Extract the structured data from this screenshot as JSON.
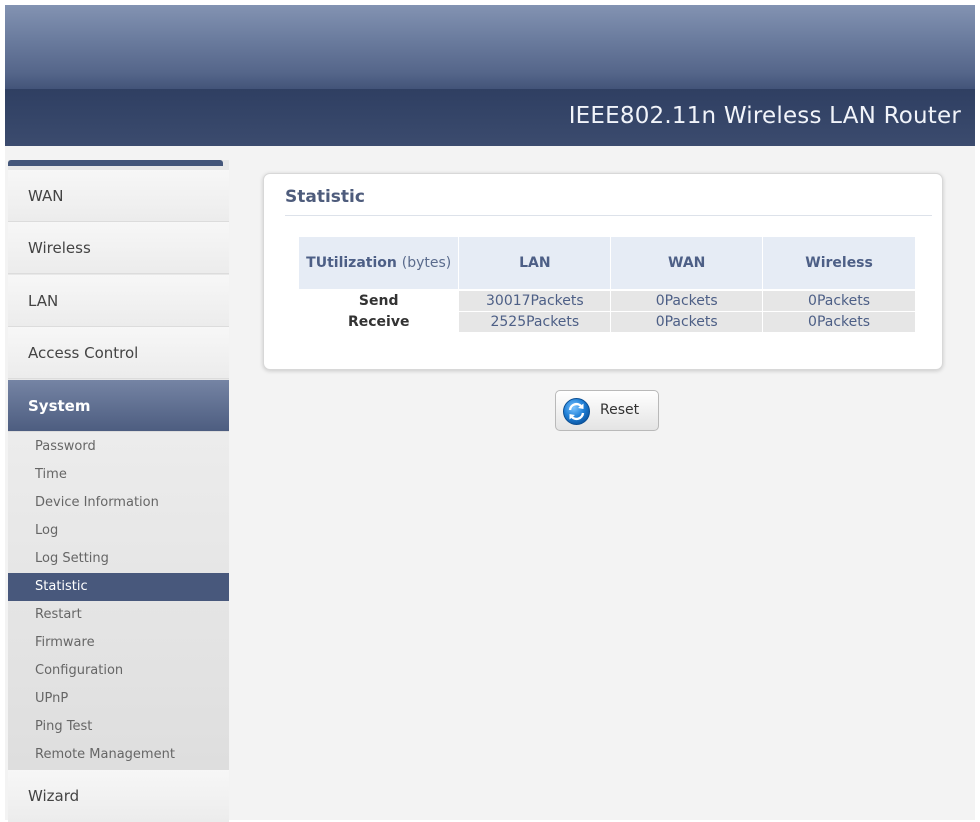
{
  "header": {
    "title": "IEEE802.11n  Wireless LAN Router"
  },
  "sidebar": {
    "nav": [
      {
        "label": "WAN"
      },
      {
        "label": "Wireless"
      },
      {
        "label": "LAN"
      },
      {
        "label": "Access Control"
      },
      {
        "label": "System"
      }
    ],
    "active": "System",
    "submenu": [
      {
        "label": "Password"
      },
      {
        "label": "Time"
      },
      {
        "label": "Device Information"
      },
      {
        "label": "Log"
      },
      {
        "label": "Log Setting"
      },
      {
        "label": "Statistic"
      },
      {
        "label": "Restart"
      },
      {
        "label": "Firmware"
      },
      {
        "label": "Configuration"
      },
      {
        "label": "UPnP"
      },
      {
        "label": "Ping Test"
      },
      {
        "label": "Remote Management"
      }
    ],
    "selected_sub": "Statistic",
    "bottom_nav": {
      "label": "Wizard"
    }
  },
  "panel": {
    "title": "Statistic",
    "table": {
      "header_main": "TUtilization",
      "header_unit": "(bytes)",
      "columns": [
        "LAN",
        "WAN",
        "Wireless"
      ],
      "rows": [
        {
          "label": "Send",
          "values": [
            "30017Packets",
            "0Packets",
            "0Packets"
          ]
        },
        {
          "label": "Receive",
          "values": [
            "2525Packets",
            "0Packets",
            "0Packets"
          ]
        }
      ]
    }
  },
  "actions": {
    "reset_label": "Reset"
  },
  "colors": {
    "accent": "#48587c",
    "header_dark": "#3a4a6e",
    "table_header_bg": "#e6ecf5",
    "cell_bg": "#e6e6e6"
  },
  "icons": {
    "reset": "refresh-icon"
  }
}
